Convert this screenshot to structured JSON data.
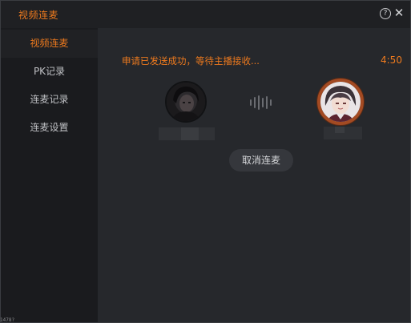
{
  "window": {
    "title": "视频连麦",
    "help_glyph": "?",
    "close_glyph": "✕"
  },
  "sidebar": {
    "items": [
      {
        "label": "视频连麦",
        "active": true
      },
      {
        "label": "PK记录",
        "active": false
      },
      {
        "label": "连麦记录",
        "active": false
      },
      {
        "label": "连麦设置",
        "active": false
      }
    ]
  },
  "main": {
    "status_text": "申请已发送成功，等待主播接收...",
    "timer": "4:50",
    "cancel_label": "取消连麦"
  },
  "colors": {
    "accent": "#ee7a1e",
    "background": "#26282c",
    "sidebar": "#1a1b1e"
  },
  "corner_fragment": "1478?"
}
